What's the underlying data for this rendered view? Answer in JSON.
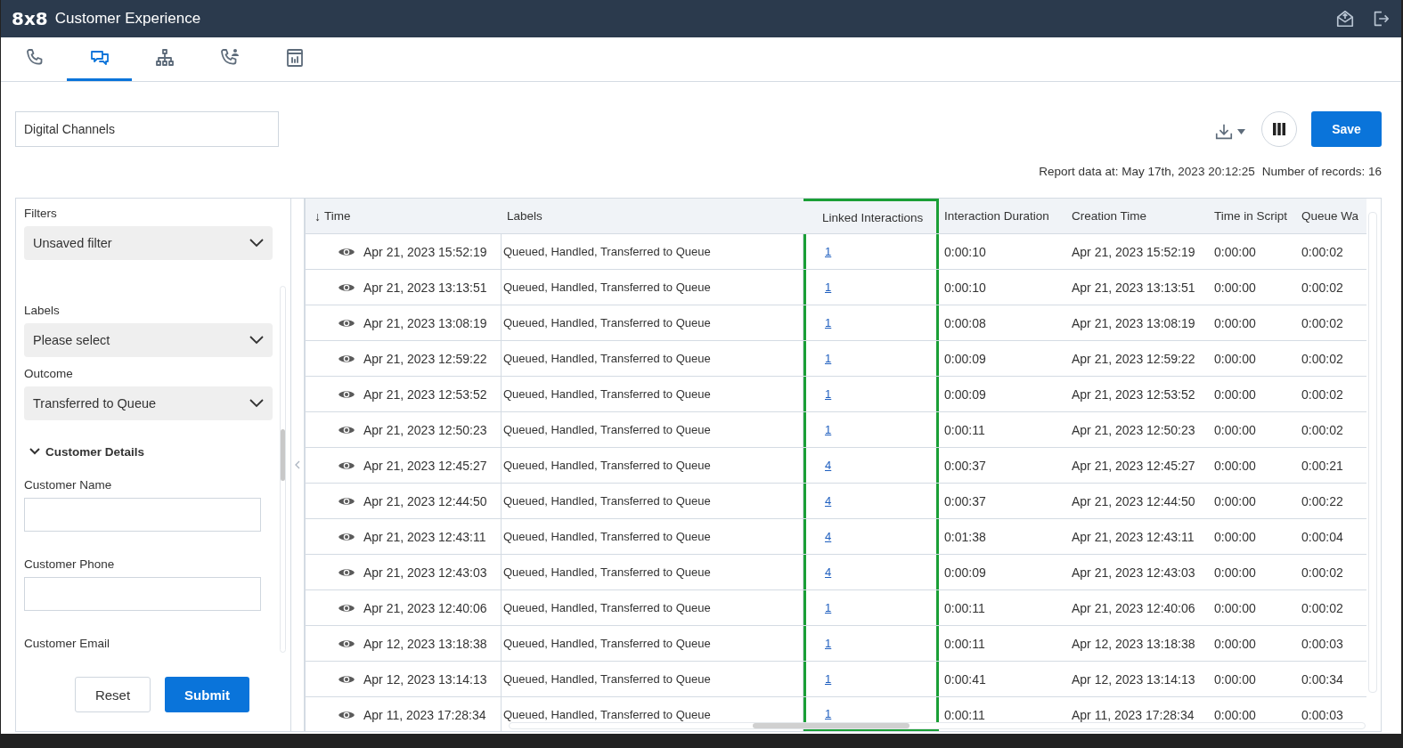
{
  "app": {
    "logo": "8x8",
    "title": "Customer Experience"
  },
  "nav_tabs": [
    {
      "kind": "phone",
      "selected": false
    },
    {
      "kind": "chat",
      "selected": true
    },
    {
      "kind": "hierarchy",
      "selected": false
    },
    {
      "kind": "contacts",
      "selected": false
    },
    {
      "kind": "report",
      "selected": false
    }
  ],
  "report_name": {
    "value": "Digital Channels"
  },
  "toolbar": {
    "save": "Save"
  },
  "report_info": {
    "data_at": "Report data at: May 17th, 2023 20:12:25",
    "records": "Number of records: 16"
  },
  "filters": {
    "fields": [
      {
        "kind": "select",
        "label": "Filters",
        "value": "Unsaved filter"
      },
      {
        "kind": "select",
        "label": "Labels",
        "value": "Please select"
      },
      {
        "kind": "select",
        "label": "Outcome",
        "value": "Transferred to Queue"
      },
      {
        "kind": "section",
        "label": "Customer Details",
        "expanded": true
      },
      {
        "kind": "input",
        "label": "Customer Name"
      },
      {
        "kind": "input",
        "label": "Customer Phone"
      },
      {
        "kind": "label",
        "label": "Customer Email"
      }
    ],
    "buttons": {
      "reset": "Reset",
      "submit": "Submit"
    }
  },
  "table": {
    "sort_indicator": "↓",
    "columns": [
      {
        "label": "Time",
        "highlighted": false
      },
      {
        "label": "Labels",
        "highlighted": false
      },
      {
        "label": "Linked Interactions",
        "highlighted": true
      },
      {
        "label": "Interaction Duration",
        "highlighted": false
      },
      {
        "label": "Creation Time",
        "highlighted": false
      },
      {
        "label": "Time in Script",
        "highlighted": false
      },
      {
        "label": "Queue Wa",
        "highlighted": false
      }
    ],
    "rows": [
      [
        "Apr 21, 2023 15:52:19",
        "Queued, Handled, Transferred to Queue",
        "1",
        "0:00:10",
        "Apr 21, 2023 15:52:19",
        "0:00:00",
        "0:00:02"
      ],
      [
        "Apr 21, 2023 13:13:51",
        "Queued, Handled, Transferred to Queue",
        "1",
        "0:00:10",
        "Apr 21, 2023 13:13:51",
        "0:00:00",
        "0:00:02"
      ],
      [
        "Apr 21, 2023 13:08:19",
        "Queued, Handled, Transferred to Queue",
        "1",
        "0:00:08",
        "Apr 21, 2023 13:08:19",
        "0:00:00",
        "0:00:02"
      ],
      [
        "Apr 21, 2023 12:59:22",
        "Queued, Handled, Transferred to Queue",
        "1",
        "0:00:09",
        "Apr 21, 2023 12:59:22",
        "0:00:00",
        "0:00:02"
      ],
      [
        "Apr 21, 2023 12:53:52",
        "Queued, Handled, Transferred to Queue",
        "1",
        "0:00:09",
        "Apr 21, 2023 12:53:52",
        "0:00:00",
        "0:00:02"
      ],
      [
        "Apr 21, 2023 12:50:23",
        "Queued, Handled, Transferred to Queue",
        "1",
        "0:00:11",
        "Apr 21, 2023 12:50:23",
        "0:00:00",
        "0:00:02"
      ],
      [
        "Apr 21, 2023 12:45:27",
        "Queued, Handled, Transferred to Queue",
        "4",
        "0:00:37",
        "Apr 21, 2023 12:45:27",
        "0:00:00",
        "0:00:21"
      ],
      [
        "Apr 21, 2023 12:44:50",
        "Queued, Handled, Transferred to Queue",
        "4",
        "0:00:37",
        "Apr 21, 2023 12:44:50",
        "0:00:00",
        "0:00:22"
      ],
      [
        "Apr 21, 2023 12:43:11",
        "Queued, Handled, Transferred to Queue",
        "4",
        "0:01:38",
        "Apr 21, 2023 12:43:11",
        "0:00:00",
        "0:00:04"
      ],
      [
        "Apr 21, 2023 12:43:03",
        "Queued, Handled, Transferred to Queue",
        "4",
        "0:00:09",
        "Apr 21, 2023 12:43:03",
        "0:00:00",
        "0:00:02"
      ],
      [
        "Apr 21, 2023 12:40:06",
        "Queued, Handled, Transferred to Queue",
        "1",
        "0:00:11",
        "Apr 21, 2023 12:40:06",
        "0:00:00",
        "0:00:02"
      ],
      [
        "Apr 12, 2023 13:18:38",
        "Queued, Handled, Transferred to Queue",
        "1",
        "0:00:11",
        "Apr 12, 2023 13:18:38",
        "0:00:00",
        "0:00:03"
      ],
      [
        "Apr 12, 2023 13:14:13",
        "Queued, Handled, Transferred to Queue",
        "1",
        "0:00:41",
        "Apr 12, 2023 13:14:13",
        "0:00:00",
        "0:00:34"
      ],
      [
        "Apr 11, 2023 17:28:34",
        "Queued, Handled, Transferred to Queue",
        "1",
        "0:00:11",
        "Apr 11, 2023 17:28:34",
        "0:00:00",
        "0:00:03"
      ]
    ]
  }
}
